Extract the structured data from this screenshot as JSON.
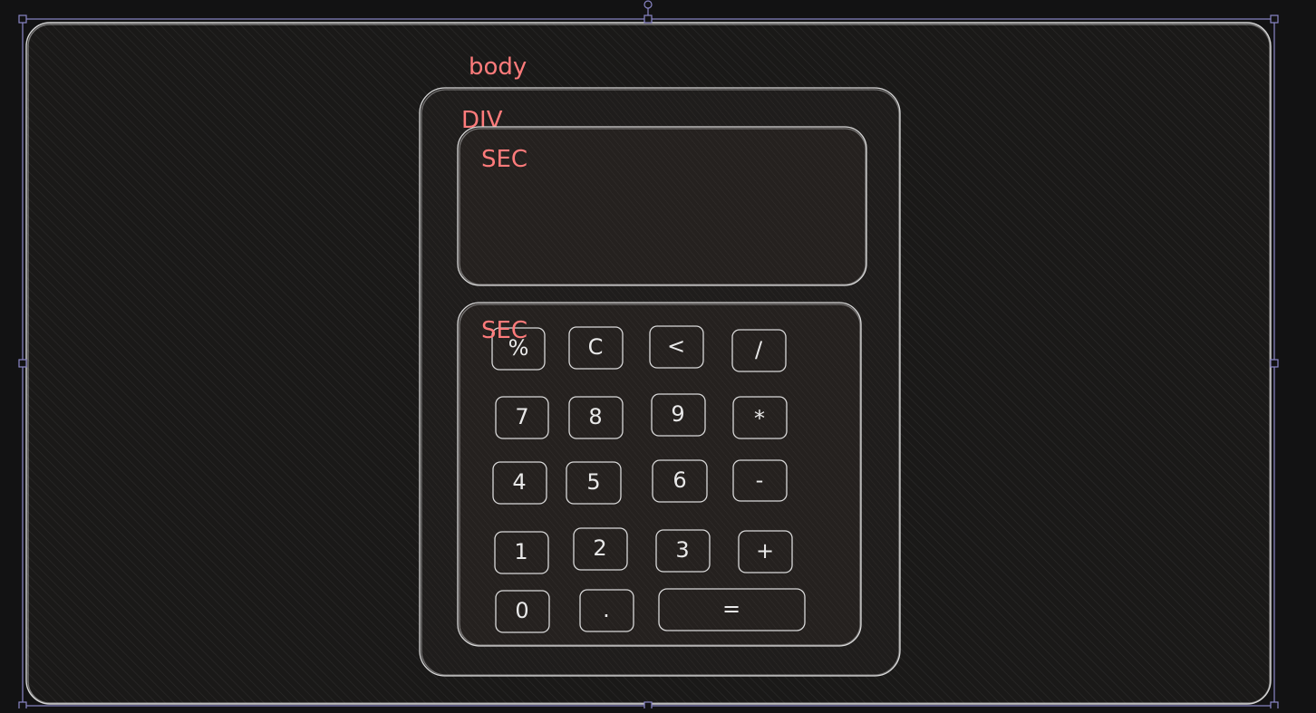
{
  "labels": {
    "body": "body",
    "div": "DIV",
    "sec_display": "SEC",
    "sec_keys": "SEC"
  },
  "keys": [
    "%",
    "C",
    "<",
    "/",
    "7",
    "8",
    "9",
    "*",
    "4",
    "5",
    "6",
    "-",
    "1",
    "2",
    "3",
    "+",
    "0",
    ".",
    "="
  ],
  "colors": {
    "background": "#121213",
    "label": "#ff7b7b",
    "stroke": "#d9d9d9",
    "selection": "#8a86c7"
  }
}
